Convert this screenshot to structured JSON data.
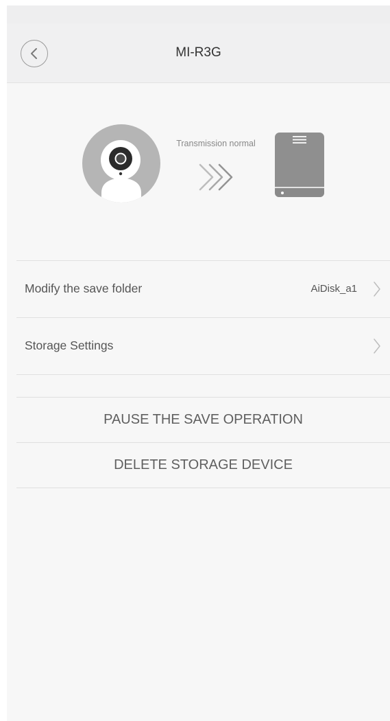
{
  "header": {
    "title": "MI-R3G",
    "back_icon": "chevron-left-icon"
  },
  "hero": {
    "transmission_status": "Transmission normal",
    "camera_icon": "security-camera-icon",
    "arrows_icon": "triple-chevron-right-icon",
    "drive_icon": "hard-drive-icon"
  },
  "settings": {
    "save_folder": {
      "label": "Modify the save folder",
      "value": "AiDisk_a1"
    },
    "storage_settings": {
      "label": "Storage Settings"
    }
  },
  "actions": {
    "pause": "PAUSE THE SAVE OPERATION",
    "delete": "DELETE STORAGE DEVICE"
  },
  "colors": {
    "background": "#f7f7f7",
    "header_background": "#f0f0f1",
    "text_primary": "#333333",
    "text_secondary": "#555555",
    "icon_gray": "#8f8f8f"
  }
}
